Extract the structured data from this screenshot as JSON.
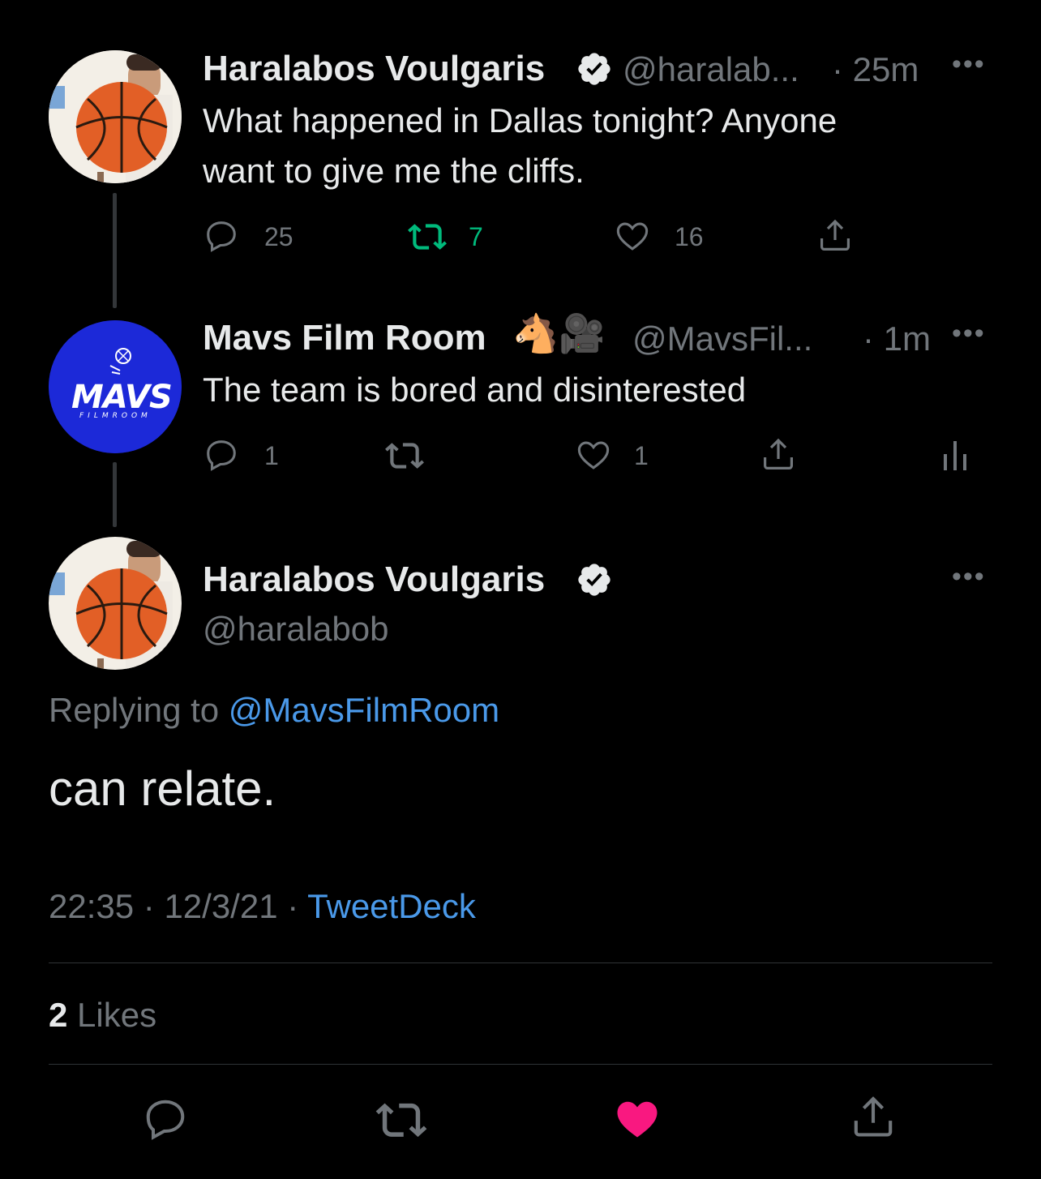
{
  "tweets": [
    {
      "display_name": "Haralabos Voulgaris",
      "handle": "@haralab...",
      "time": "· 25m",
      "text_line1": "What happened in Dallas tonight? Anyone",
      "text_line2": "want to give me the cliffs.",
      "replies": "25",
      "retweets": "7",
      "likes": "16"
    },
    {
      "display_name": "Mavs Film Room",
      "emoji": "🐴🎥",
      "handle": "@MavsFil...",
      "time": "· 1m",
      "text": "The team is bored and disinterested",
      "replies": "1",
      "likes": "1",
      "avatar_logo_text": "MAVS",
      "avatar_logo_subtext": "FILMROOM"
    }
  ],
  "main_tweet": {
    "display_name": "Haralabos Voulgaris",
    "handle": "@haralabob",
    "replying_label": "Replying to",
    "replying_to": "@MavsFilmRoom",
    "text": "can relate.",
    "time": "22:35",
    "sep1": " · ",
    "date": "12/3/21",
    "sep2": " · ",
    "source": "TweetDeck",
    "likes_count": "2",
    "likes_label": "Likes"
  },
  "colors": {
    "background": "#000000",
    "text": "#e7e9ea",
    "muted": "#71767b",
    "link": "#4a99e9",
    "retweet_green": "#00ba7c",
    "like_pink": "#f91880",
    "mavs_blue": "#1d2bd6"
  },
  "icons": [
    "verified-badge-icon",
    "reply-icon",
    "retweet-icon",
    "like-icon",
    "share-icon",
    "analytics-icon",
    "more-icon"
  ]
}
